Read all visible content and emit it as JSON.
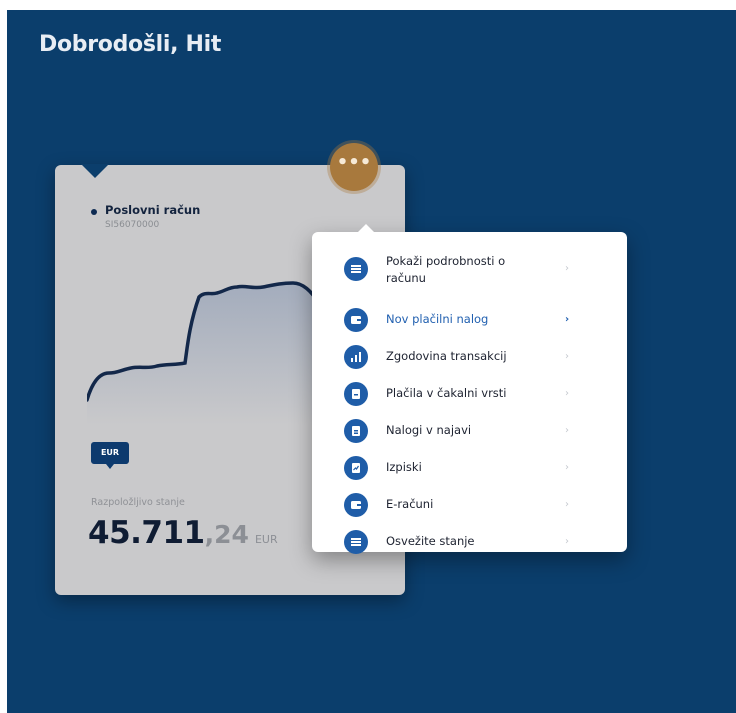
{
  "header": {
    "greeting": "Dobrodošli, Hit"
  },
  "account_card": {
    "name": "Poslovni račun",
    "number": "SI56070000",
    "currency_badge": "EUR",
    "balance_label": "Razpoložljivo stanje",
    "balance_integer": "45.711",
    "balance_decimal": ",24",
    "balance_currency": "EUR"
  },
  "more_button": {
    "label": "•••"
  },
  "menu": {
    "items": [
      {
        "label": "Pokaži podrobnosti o računu",
        "icon": "document-icon",
        "active": false
      },
      {
        "label": "Nov plačilni nalog",
        "icon": "wallet-icon",
        "active": true
      },
      {
        "label": "Zgodovina transakcij",
        "icon": "chart-icon",
        "active": false
      },
      {
        "label": "Plačila v čakalni vrsti",
        "icon": "queue-document-icon",
        "active": false
      },
      {
        "label": "Nalogi v najavi",
        "icon": "file-icon",
        "active": false
      },
      {
        "label": "Izpiski",
        "icon": "statement-icon",
        "active": false
      },
      {
        "label": "E-računi",
        "icon": "e-invoice-icon",
        "active": false
      },
      {
        "label": "Osvežite stanje",
        "icon": "refresh-icon",
        "active": false
      }
    ],
    "chevron": "›"
  },
  "colors": {
    "background": "#0b3e6c",
    "card": "#c9c9cb",
    "accent_button": "#a8793d",
    "menu_icon": "#1f5da8",
    "active_text": "#2160b0"
  }
}
